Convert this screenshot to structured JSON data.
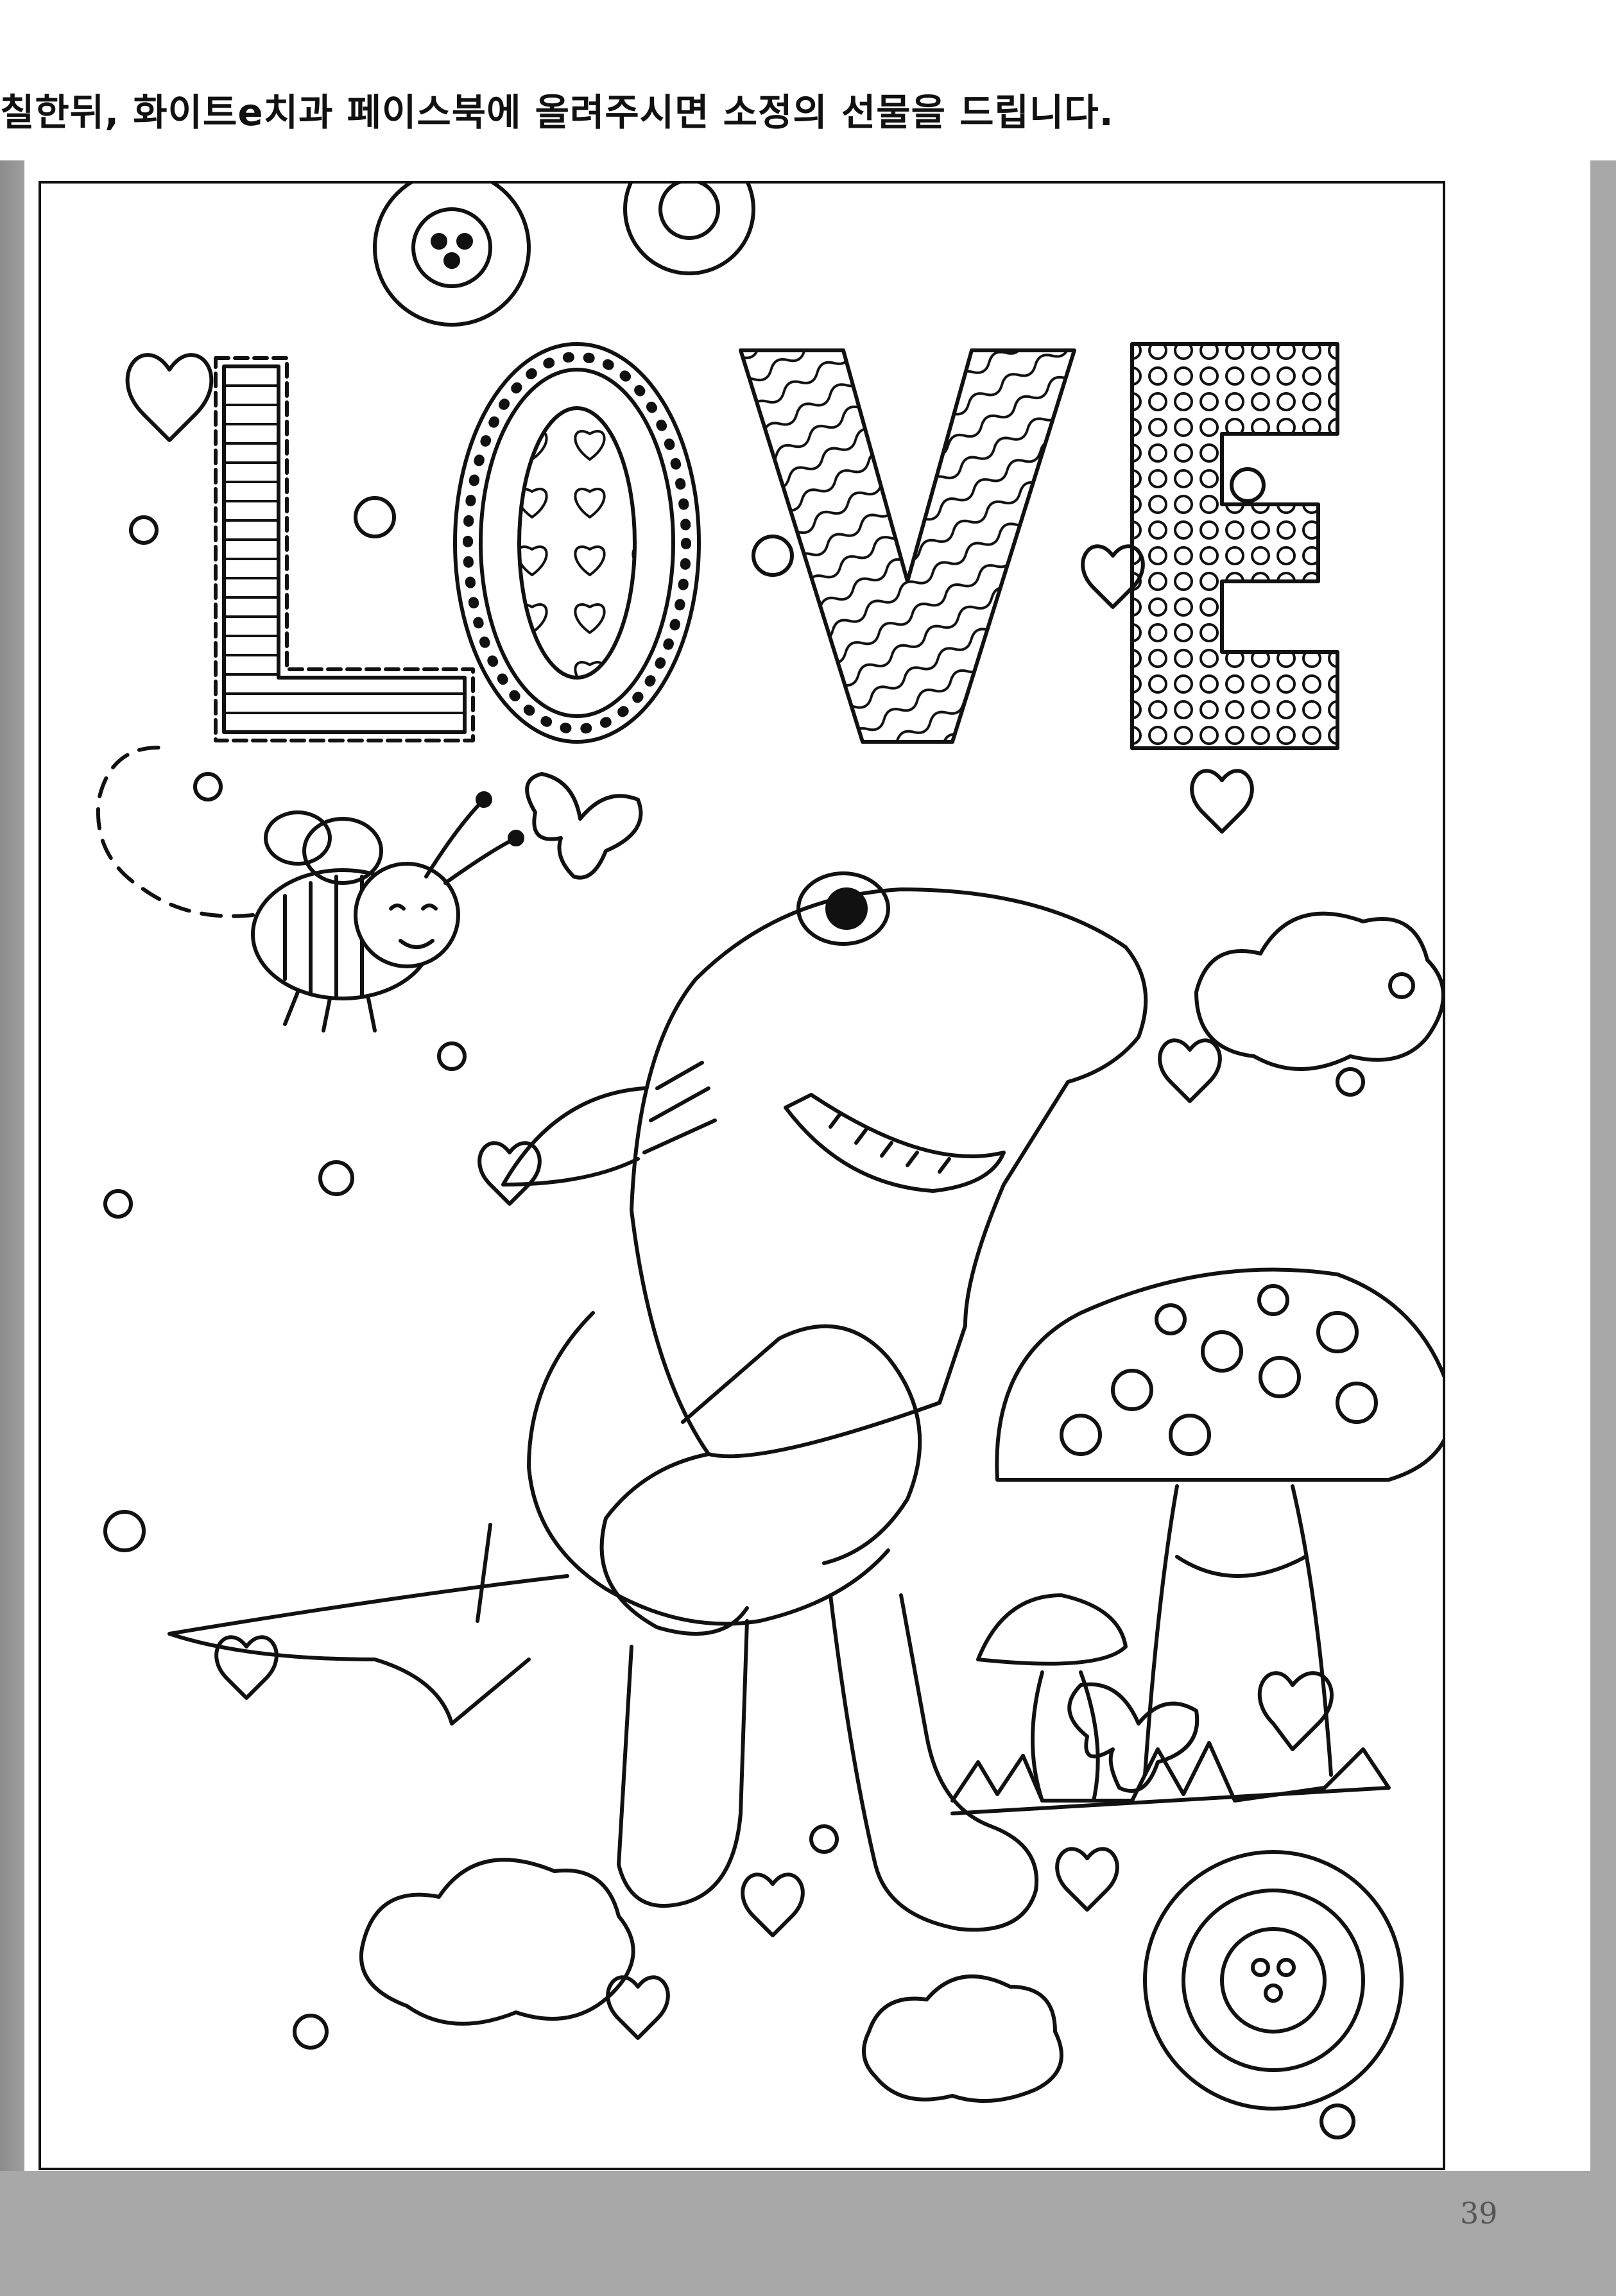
{
  "header": {
    "instruction": "칠한뒤, 화이트e치과 페이스북에 올려주시면 소정의 선물을 드립니다."
  },
  "artwork": {
    "title_letters": [
      "L",
      "O",
      "V",
      "E"
    ]
  },
  "footer": {
    "page_number": "39"
  }
}
